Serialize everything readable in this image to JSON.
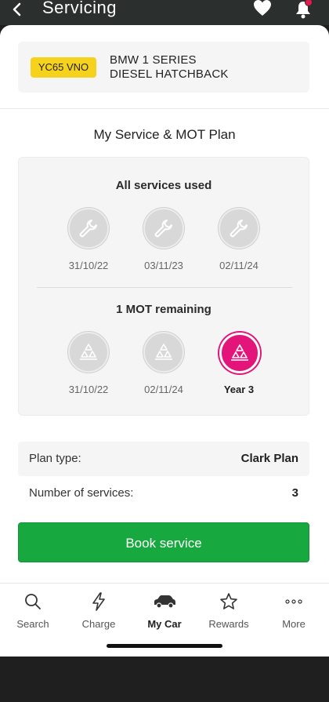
{
  "header": {
    "title": "Servicing"
  },
  "vehicle": {
    "plate": "YC65 VNO",
    "model_line1": "BMW 1 SERIES",
    "model_line2": "DIESEL HATCHBACK"
  },
  "plan": {
    "title": "My Service & MOT Plan",
    "services_heading": "All services used",
    "services": [
      {
        "date": "31/10/22"
      },
      {
        "date": "03/11/23"
      },
      {
        "date": "02/11/24"
      }
    ],
    "mot_heading": "1 MOT remaining",
    "mots": [
      {
        "label": "31/10/22",
        "status": "used"
      },
      {
        "label": "02/11/24",
        "status": "used"
      },
      {
        "label": "Year 3",
        "status": "remaining"
      }
    ]
  },
  "details": [
    {
      "key": "Plan type:",
      "value": "Clark Plan"
    },
    {
      "key": "Number of services:",
      "value": "3"
    }
  ],
  "actions": {
    "book_label": "Book service"
  },
  "nav": {
    "items": [
      {
        "label": "Search",
        "icon": "search-icon"
      },
      {
        "label": "Charge",
        "icon": "lightning-icon"
      },
      {
        "label": "My Car",
        "icon": "car-icon",
        "active": true
      },
      {
        "label": "Rewards",
        "icon": "star-icon"
      },
      {
        "label": "More",
        "icon": "more-icon"
      }
    ]
  },
  "colors": {
    "accent_green": "#17a93f",
    "mot_active": "#e4157a",
    "plate_yellow": "#f6d21d"
  }
}
